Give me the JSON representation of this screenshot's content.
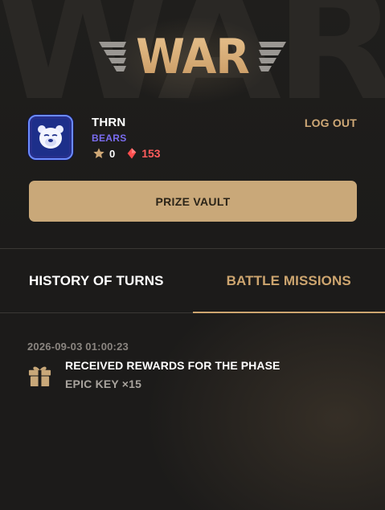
{
  "header": {
    "background_word": "WAR",
    "logo_text": "WAR",
    "logout_label": "LOG OUT",
    "prize_vault_label": "PRIZE VAULT"
  },
  "profile": {
    "avatar_icon": "bear-face-icon",
    "user_name": "THRN",
    "team_name": "BEARS",
    "stars": "0",
    "gems": "153"
  },
  "tabs": [
    {
      "label": "HISTORY OF TURNS",
      "active": false
    },
    {
      "label": "BATTLE MISSIONS",
      "active": true
    }
  ],
  "history": [
    {
      "timestamp": "2026-09-03 01:00:23",
      "icon": "gift-icon",
      "title": "RECEIVED REWARDS FOR THE PHASE",
      "reward": "EPIC KEY ×15"
    }
  ],
  "colors": {
    "background": "#1c1b1a",
    "accent_gold": "#c9a879",
    "tab_active": "#cda56f",
    "team_purple": "#7a6cf0",
    "gem_red": "#ff5c5c",
    "muted_text": "#8a8580"
  }
}
